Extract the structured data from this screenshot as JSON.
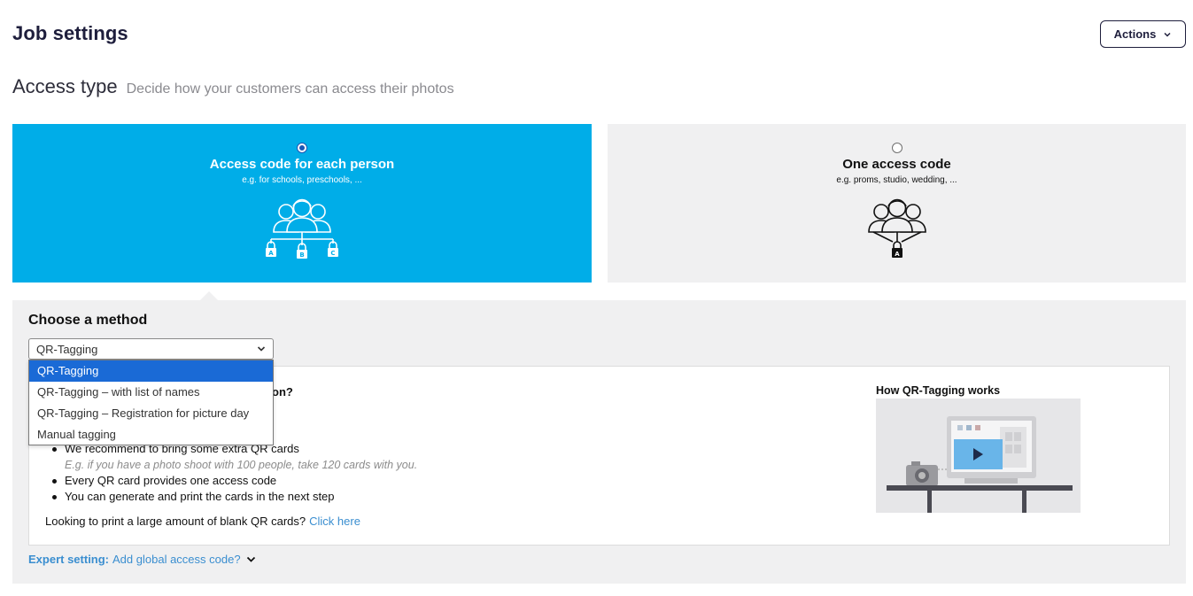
{
  "header": {
    "title": "Job settings",
    "actions_label": "Actions"
  },
  "access_type": {
    "title": "Access type",
    "subtitle": "Decide how your customers can access their photos",
    "options": [
      {
        "title": "Access code for each person",
        "subtitle": "e.g. for schools, preschools, ...",
        "selected": true,
        "icon": "group-multi-lock-icon",
        "lock_letters": [
          "A",
          "B",
          "C"
        ]
      },
      {
        "title": "One access code",
        "subtitle": "e.g. proms, studio, wedding, ...",
        "selected": false,
        "icon": "group-single-lock-icon",
        "lock_letters": [
          "A"
        ]
      }
    ]
  },
  "method": {
    "title": "Choose a method",
    "selected_value": "QR-Tagging",
    "options": [
      "QR-Tagging",
      "QR-Tagging – with list of names",
      "QR-Tagging – Registration for picture day",
      "Manual tagging"
    ]
  },
  "info": {
    "question_tail": "on?",
    "list": [
      {
        "text": "We recommend to bring some extra QR cards",
        "type": "bullet"
      },
      {
        "text": "E.g. if you have a photo shoot with 100 people, take 120 cards with you.",
        "type": "hint"
      },
      {
        "text": "Every QR card provides one access code",
        "type": "bullet"
      },
      {
        "text": "You can generate and print the cards in the next step",
        "type": "bullet"
      }
    ],
    "blank_cards_text": "Looking to print a large amount of blank QR cards?",
    "blank_cards_link": "Click here",
    "video_title": "How QR-Tagging works"
  },
  "expert": {
    "label": "Expert setting:",
    "link": "Add global access code?"
  },
  "colors": {
    "accent_blue": "#00ade8",
    "link_blue": "#3a8ed0",
    "dark_navy": "#1e1e3c",
    "panel_grey": "#f0f0f1",
    "select_highlight": "#1a6ad6"
  }
}
